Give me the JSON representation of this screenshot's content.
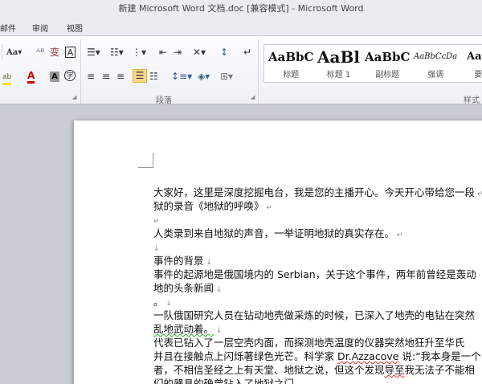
{
  "window": {
    "title": "新建 Microsoft Word 文档.doc [兼容模式]  -  Microsoft Word"
  },
  "tabs": [
    {
      "label": "邮件"
    },
    {
      "label": "审阅"
    },
    {
      "label": "视图"
    }
  ],
  "ribbon": {
    "font_group": {
      "change_case": "Aa",
      "highlight": "ab",
      "font_color": "A"
    },
    "paragraph_group": {
      "label": "段落"
    },
    "styles_group": {
      "label": "样式",
      "styles": [
        {
          "sample": "AaBbC",
          "name": "标题"
        },
        {
          "sample": "AaBl",
          "name": "标题 1"
        },
        {
          "sample": "AaBbC",
          "name": "副标题"
        },
        {
          "sample": "AaBbCcDa",
          "name": "强调"
        },
        {
          "sample": "AaBb",
          "name": "要点"
        }
      ]
    }
  },
  "document": {
    "lines": [
      "大家好，这里是深度挖掘电台，我是您的主播开心。今天开心带给您一段",
      "狱的录音《地狱的呼唤》",
      "",
      "人类录到来自地狱的声音，一举证明地狱的真实存在。",
      "",
      "事件的背景",
      "事件的起源地是俄国境内的 Serbian，关于这个事件，两年前曾经是轰动",
      "地的头条新闻",
      "。",
      "一队俄国研究人员在钻动地壳做采炼的时候，已深入了地壳的电钻在突然",
      "乱地武动着。",
      "代表已钻入了一层空壳内面，而探测地壳温度的仪器突然地狂升至华氏",
      "并且在接触点上闪烁著绿色光芒。科学家 Dr.Azzacove 说:“我本身是一个",
      "者，不相信圣经之上有天堂、地狱之说，但这个发现导至我无法子不能相",
      "们的器具的确曾钻入了地狱之门。"
    ],
    "marks": [
      "↵",
      "↵",
      "↵",
      "↵",
      "↓",
      "↓",
      "",
      "↓",
      "↓",
      "",
      "↓",
      "",
      "",
      "",
      ""
    ]
  }
}
